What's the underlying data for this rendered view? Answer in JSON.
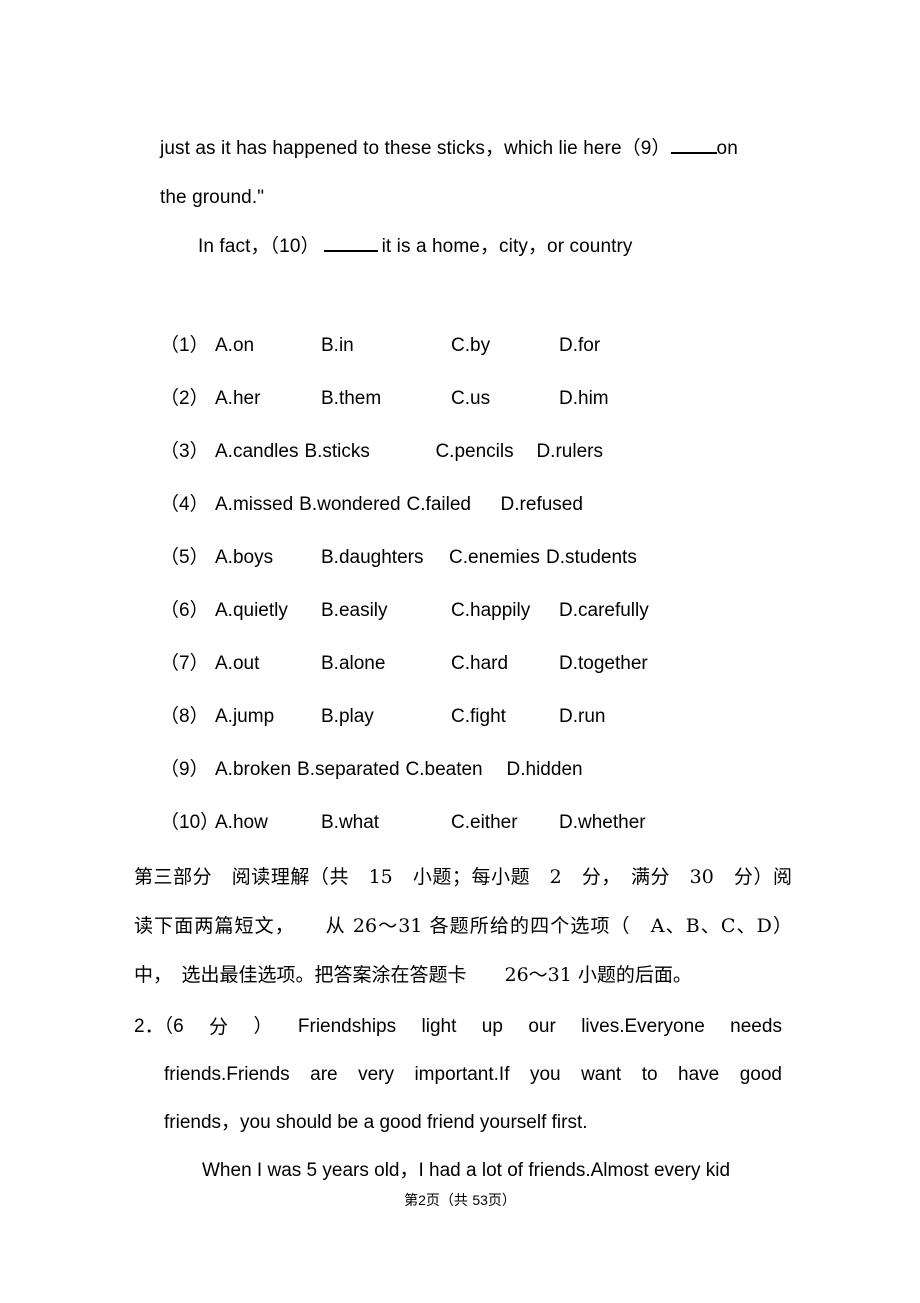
{
  "document": {
    "passage_top": {
      "line1_a": "just as it has happened to these sticks，which lie here（9）",
      "line1_b": "on",
      "line2": "the ground.\"",
      "line3_a": "In fact，（10）",
      "line3_b": "it is a home，city，or country"
    },
    "options": [
      {
        "num": "（1）",
        "a": "A.on",
        "b": "B.in",
        "c": "C.by",
        "d": "D.for",
        "wide": false
      },
      {
        "num": "（2）",
        "a": "A.her",
        "b": "B.them",
        "c": "C.us",
        "d": "D.him",
        "wide": false
      },
      {
        "num": "（3）",
        "a": "A.candles",
        "b": "B.sticks",
        "c": "C.pencils",
        "d": "D.rulers",
        "wide": true
      },
      {
        "num": "（4）",
        "a": "A.missed",
        "b": "B.wondered",
        "c": "C.failed",
        "d": "D.refused",
        "wide": true
      },
      {
        "num": "（5）",
        "a": "A.boys",
        "b": "B.daughters",
        "c": "C.enemies",
        "d": "D.students",
        "wide": false
      },
      {
        "num": "（6）",
        "a": "A.quietly",
        "b": "B.easily",
        "c": "C.happily",
        "d": "D.carefully",
        "wide": false
      },
      {
        "num": "（7）",
        "a": "A.out",
        "b": "B.alone",
        "c": "C.hard",
        "d": "D.together",
        "wide": false
      },
      {
        "num": "（8）",
        "a": "A.jump",
        "b": "B.play",
        "c": "C.fight",
        "d": "D.run",
        "wide": false
      },
      {
        "num": "（9）",
        "a": "A.broken",
        "b": "B.separated",
        "c": "C.beaten",
        "d": "D.hidden",
        "wide": true
      },
      {
        "num": "（10）",
        "a": "A.how",
        "b": "B.what",
        "c": "C.either",
        "d": "D.whether",
        "wide": false
      }
    ],
    "section3": {
      "line1": "第三部分　阅读理解（共　15　小题；每小题　2　分，　满分　30　分）阅",
      "line2": "读下面两篇短文，　　从 26～31 各题所给的四个选项（　A、B、C、D）",
      "line3": "中，　选出最佳选项。把答案涂在答题卡　　26～31 小题的后面。"
    },
    "question2": {
      "label": "2．（6",
      "label_cn": "分",
      "label_close": "）",
      "line1_words": [
        "Friendships",
        "light",
        "up",
        "our",
        "lives.Everyone",
        "needs"
      ],
      "line2_words": [
        "friends.Friends",
        "are",
        "very",
        "important.If",
        "you",
        "want",
        "to",
        "have",
        "good"
      ],
      "line3": "friends，you should be a good friend yourself first.",
      "line4": "When I was 5 years old，I had a lot of friends.Almost every kid"
    },
    "footer": {
      "prefix": "第",
      "page": "2",
      "mid": "页（共",
      "total": "53",
      "suffix": "页）"
    }
  }
}
